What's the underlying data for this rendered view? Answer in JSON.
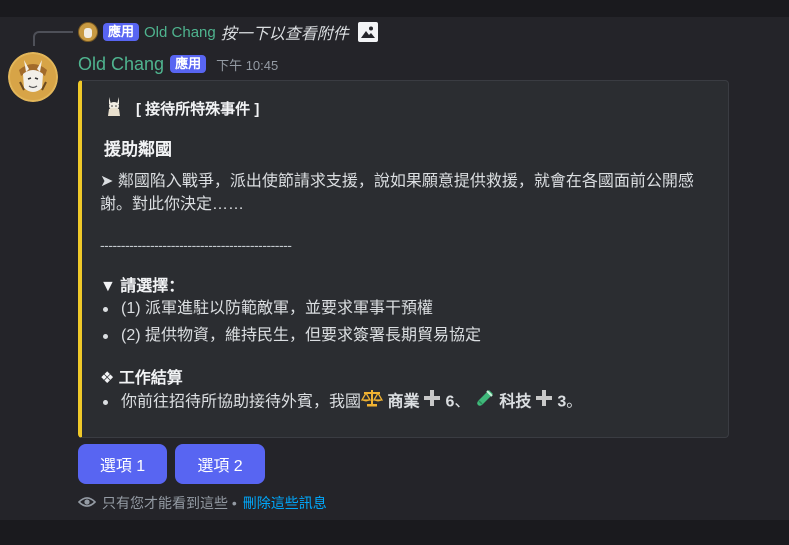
{
  "reply": {
    "app_badge": "應用",
    "author": "Old Chang",
    "text": "按一下以查看附件",
    "image_icon": "image-icon"
  },
  "message": {
    "author": "Old Chang",
    "app_badge": "應用",
    "timestamp": "下午 10:45"
  },
  "embed": {
    "accent_color": "#f0c929",
    "title_icon": "rabbit-figure-icon",
    "title": "[ 接待所特殊事件 ]",
    "heading": "援助鄰國",
    "description": "➤ 鄰國陷入戰爭，派出使節請求支援，說如果願意提供救援，就會在各國面前公開感謝。對此你決定……",
    "divider": "----------------------------------------------",
    "choose_title": "▼ 請選擇：",
    "options": [
      "(1) 派軍進駐以防範敵軍，並要求軍事干預權",
      "(2) 提供物資，維持民生，但要求簽署長期貿易協定"
    ],
    "work_title": "❖ 工作結算",
    "result": {
      "prefix": "你前往招待所協助接待外賓，我國",
      "stat1_icon": "balance-scale-icon",
      "stat1_label": "商業",
      "stat1_value": "6",
      "separator": "、",
      "stat2_icon": "test-tube-icon",
      "stat2_label": "科技",
      "stat2_value": "3",
      "suffix": "。"
    }
  },
  "buttons": [
    {
      "label": "選項 1"
    },
    {
      "label": "選項 2"
    }
  ],
  "footer": {
    "text": "只有您才能看到這些 •",
    "link": "刪除這些訊息"
  },
  "colors": {
    "author": "#4fb48f",
    "badge": "#5865f2",
    "button": "#5865f2",
    "link": "#00a8fc"
  }
}
